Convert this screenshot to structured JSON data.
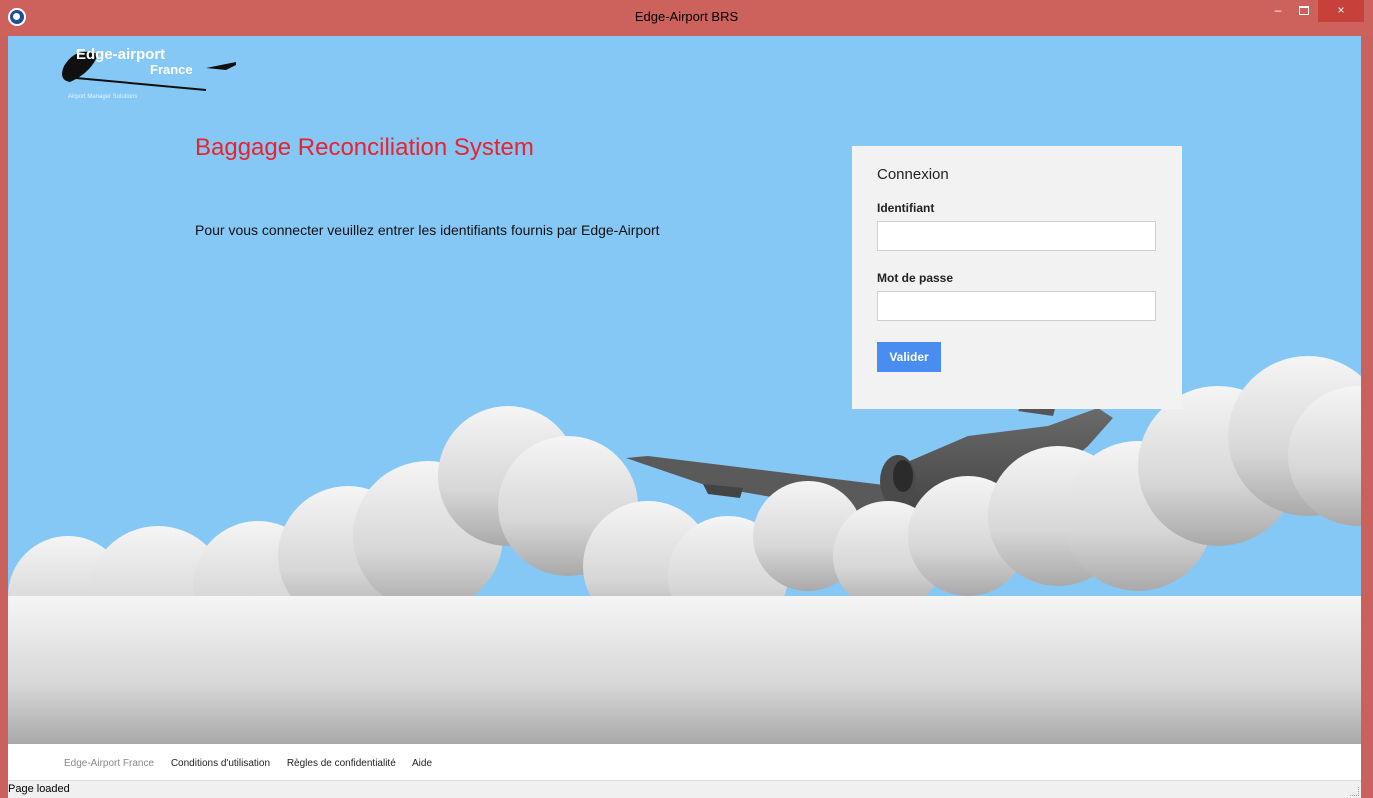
{
  "window": {
    "title": "Edge-Airport BRS",
    "controls": {
      "minimize": "–",
      "close": "×"
    }
  },
  "logo": {
    "line1": "Edge-airport",
    "line2": "France",
    "tagline": "Airport Manager Solutions"
  },
  "page": {
    "title": "Baggage Reconciliation System",
    "instructions": "Pour vous connecter veuillez entrer les identifiants fournis par Edge-Airport"
  },
  "login": {
    "heading": "Connexion",
    "username_label": "Identifiant",
    "username_value": "",
    "password_label": "Mot de passe",
    "password_value": "",
    "submit_label": "Valider"
  },
  "footer": {
    "links": [
      "Edge-Airport France",
      "Conditions d'utilisation",
      "Règles de confidentialité",
      "Aide"
    ]
  },
  "status": {
    "text": "Page loaded"
  },
  "colors": {
    "titlebar": "#cd625c",
    "sky": "#85c8f6",
    "title_red": "#e8232d",
    "button_blue": "#4a8df0"
  }
}
